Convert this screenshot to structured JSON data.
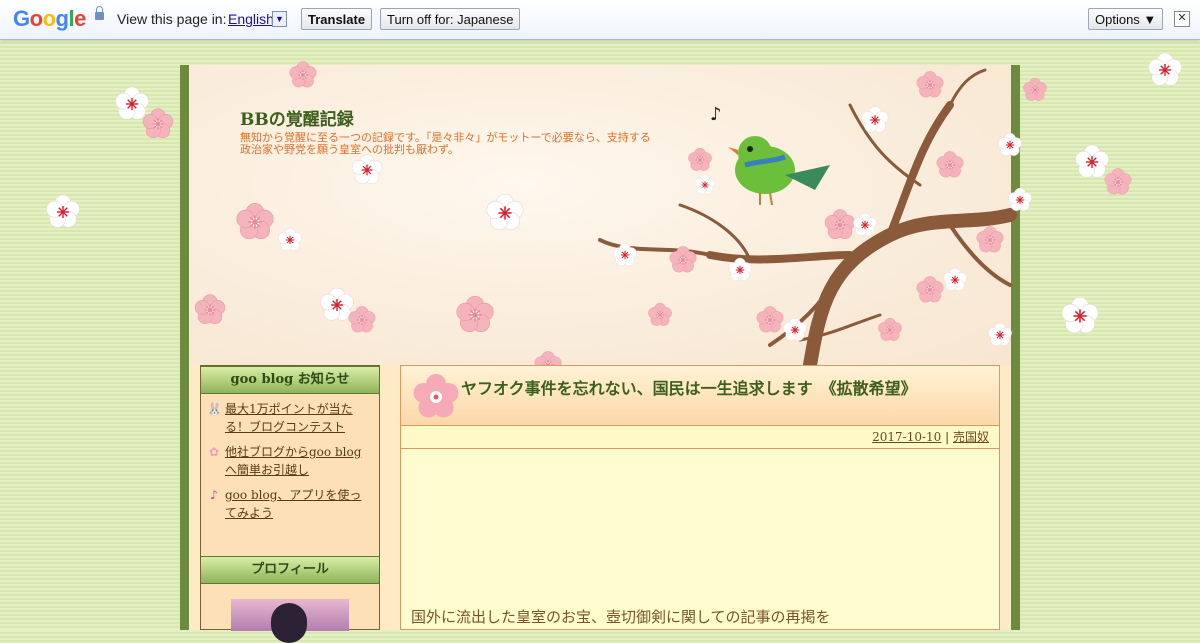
{
  "translate_bar": {
    "logo": "Google",
    "view_text": "View this page in:",
    "language": "English",
    "translate_button": "Translate",
    "turn_off_button": "Turn off for: Japanese",
    "options_button": "Options ▼",
    "close_symbol": "✕"
  },
  "blog": {
    "title": "BBの覚醒記録",
    "description": "無知から覚醒に至る一つの記録です。「是々非々」がモットーで必要なら、支持する政治家や野党を願う皇室への批判も厭わず。"
  },
  "sidebar": {
    "notice_heading": "goo blog お知らせ",
    "news": [
      {
        "icon": "rabbit-icon",
        "label": "最大1万ポイントが当たる！ブログコンテスト"
      },
      {
        "icon": "flower-icon",
        "label": "他社ブログからgoo blogへ簡単お引越し"
      },
      {
        "icon": "music-note-icon",
        "label": "goo blog、アプリを使ってみよう"
      }
    ],
    "profile_heading": "プロフィール"
  },
  "article": {
    "title": "ヤフオク事件を忘れない、国民は一生追求します　《拡散希望》",
    "date": "2017-10-10",
    "separator": "|",
    "category": "売国奴",
    "body_text": "国外に流出した皇室のお宝、壺切御剣に関しての記事の再掲を"
  },
  "colors": {
    "accent_green": "#3d5f1d",
    "frame_green": "#6d8a3e",
    "desc_orange": "#e0702a"
  }
}
